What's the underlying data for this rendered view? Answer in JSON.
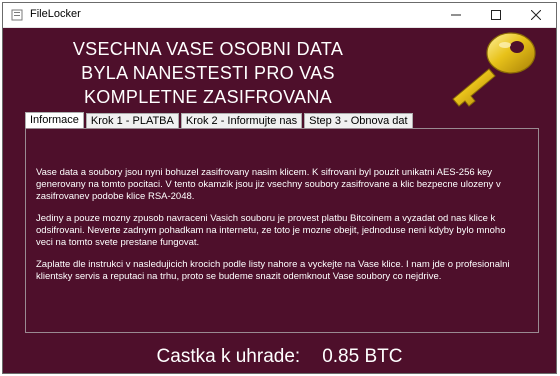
{
  "window": {
    "title": "FileLocker"
  },
  "headline": [
    "VSECHNA VASE OSOBNI DATA",
    "BYLA NANESTESTI PRO VAS",
    "KOMPLETNE ZASIFROVANA"
  ],
  "tabs": [
    {
      "label": "Informace",
      "active": true
    },
    {
      "label": "Krok 1 - PLATBA"
    },
    {
      "label": "Krok 2 - Informujte nas"
    },
    {
      "label": "Step 3 - Obnova dat"
    }
  ],
  "body": {
    "paragraphs": [
      "Vase data a soubory jsou nyni bohuzel zasifrovany nasim klicem. K sifrovani byl pouzit unikatni AES-256 key generovany na tomto pocitaci. V tento okamzik jsou jiz vsechny soubory zasifrovane a klic bezpecne ulozeny v zasifrovanev podobe klice RSA-2048.",
      "Jediny a pouze mozny zpusob navraceni Vasich souboru je provest platbu Bitcoinem a vyzadat od nas klice k odsifrovani. Neverte zadnym pohadkam na internetu, ze toto je mozne obejit, jednoduse neni kdyby bylo mnoho veci na tomto svete prestane fungovat.",
      "Zaplatte dle instrukci v nasledujicich krocich podle listy nahore a vyckejte na Vase klice. I nam jde o profesionalni klientsky servis a reputaci na trhu, proto se budeme snazit odemknout Vase soubory co nejdrive."
    ]
  },
  "amount": {
    "label": "Castka k uhrade:",
    "value": "0.85 BTC"
  },
  "colors": {
    "background": "#4e0f2b",
    "text": "#ffffff",
    "key": "#e8c21a"
  }
}
